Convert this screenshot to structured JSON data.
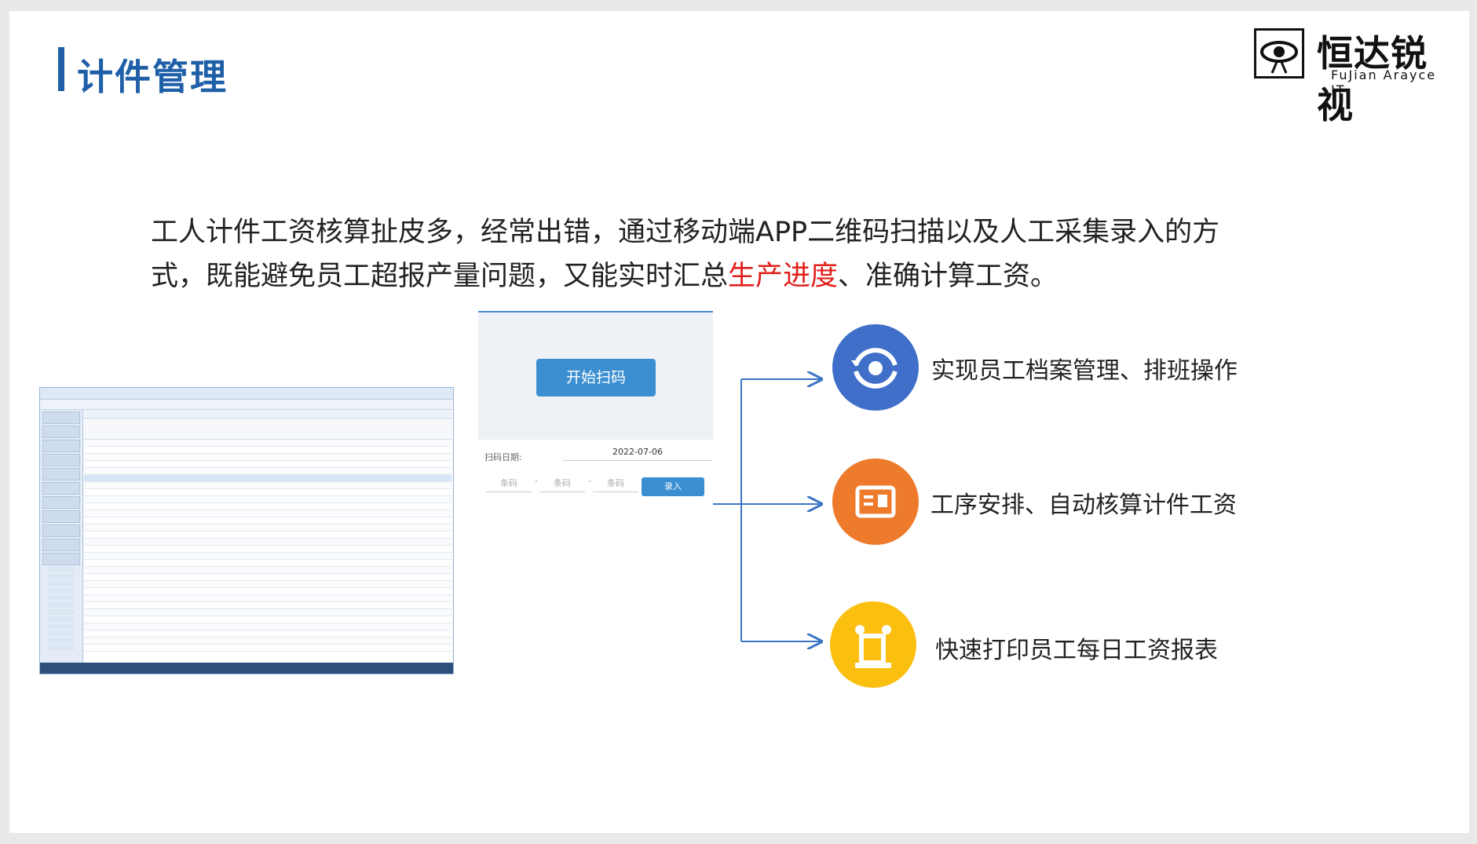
{
  "slide": {
    "title": "计件管理",
    "logo": {
      "cn": "恒达锐视",
      "en": "FuJian Arayce IT"
    },
    "intro": {
      "text_before": "工人计件工资核算扯皮多，经常出错，通过移动端APP二维码扫描以及人工采集录入的方式，既能避免员工超报产量问题，又能实时汇总",
      "highlight": "生产进度",
      "text_after": "、准确计算工资。",
      "highlight_color": "#e0201b"
    }
  },
  "scan_panel": {
    "start_button": "开始扫码",
    "date_label": "扫码日期:",
    "date_value": "2022-07-06",
    "barcode_placeholder_1": "条码",
    "barcode_placeholder_2": "条码",
    "barcode_placeholder_3": "条码",
    "dash": "-",
    "submit_button": "录入"
  },
  "features": [
    {
      "text": "实现员工档案管理、排班操作",
      "color": "#3f6fc9",
      "icon": "eye-sync-icon"
    },
    {
      "text": "工序安排、自动核算计件工资",
      "color": "#ee7b2c",
      "icon": "id-card-icon"
    },
    {
      "text": "快速打印员工每日工资报表",
      "color": "#fbbf10",
      "icon": "robot-arm-icon"
    }
  ],
  "colors": {
    "brand_blue": "#1f5fa8",
    "arrow_blue": "#3a74c4"
  }
}
